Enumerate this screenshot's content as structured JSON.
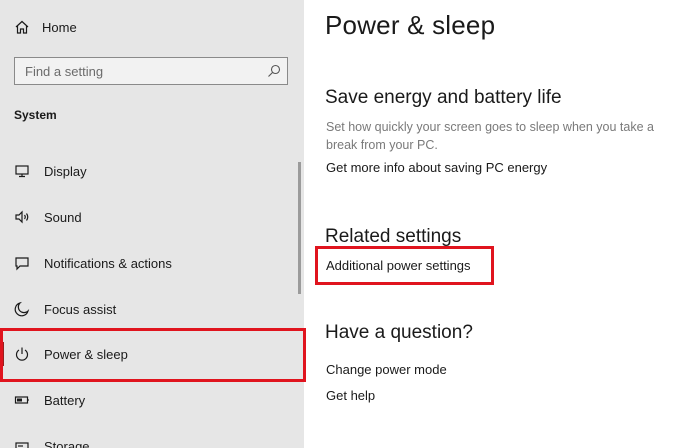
{
  "sidebar": {
    "home_label": "Home",
    "search": {
      "placeholder": "Find a setting"
    },
    "section_title": "System",
    "items": [
      {
        "label": "Display",
        "icon": "monitor-icon"
      },
      {
        "label": "Sound",
        "icon": "speaker-icon"
      },
      {
        "label": "Notifications & actions",
        "icon": "message-icon"
      },
      {
        "label": "Focus assist",
        "icon": "moon-icon"
      },
      {
        "label": "Power & sleep",
        "icon": "power-icon",
        "selected": true
      },
      {
        "label": "Battery",
        "icon": "battery-icon"
      },
      {
        "label": "Storage",
        "icon": "storage-icon"
      }
    ]
  },
  "main": {
    "title": "Power & sleep",
    "save_energy": {
      "heading": "Save energy and battery life",
      "description": "Set how quickly your screen goes to sleep when you take a break from your PC.",
      "link": "Get more info about saving PC energy"
    },
    "related": {
      "heading": "Related settings",
      "link": "Additional power settings"
    },
    "question": {
      "heading": "Have a question?",
      "links": [
        "Change power mode",
        "Get help"
      ]
    }
  },
  "colors": {
    "sidebar_bg": "#e6e6e6",
    "accent": "#9a1e1e",
    "highlight": "#e0141e"
  }
}
